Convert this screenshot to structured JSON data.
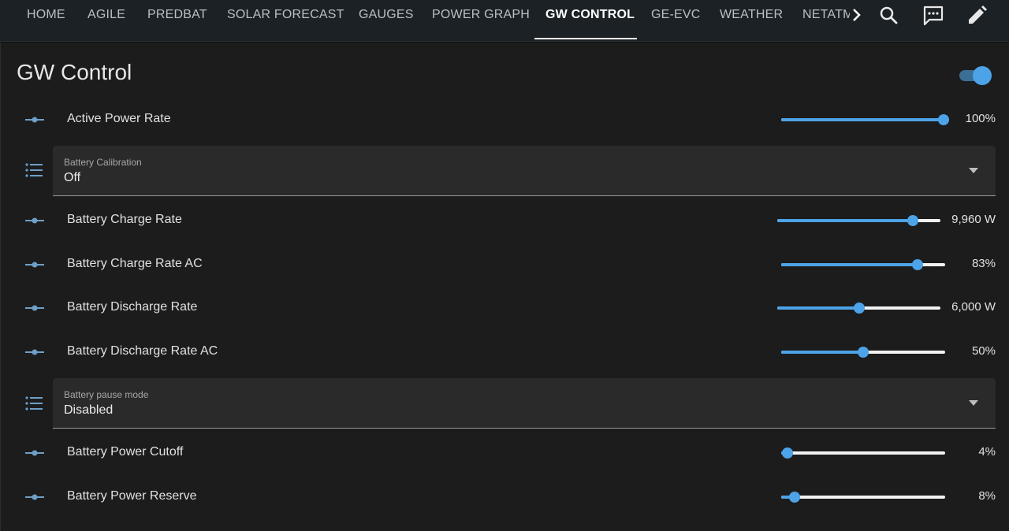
{
  "tabs": [
    {
      "label": "HOME"
    },
    {
      "label": "AGILE"
    },
    {
      "label": "PREDBAT"
    },
    {
      "label": "SOLAR FORECAST"
    },
    {
      "label": "GAUGES"
    },
    {
      "label": "POWER GRAPH"
    },
    {
      "label": "GW CONTROL"
    },
    {
      "label": "GE-EVC"
    },
    {
      "label": "WEATHER"
    },
    {
      "label": "NETATM"
    }
  ],
  "active_tab": "GW CONTROL",
  "toolbar_icons": [
    "search-icon",
    "chat-icon",
    "edit-icon"
  ],
  "accent_color": "#4da3e8",
  "card": {
    "title": "GW Control",
    "toggle_on": true
  },
  "rows": [
    {
      "label": "Active Power Rate",
      "value": "100%",
      "level": 1.0
    },
    {
      "select_label": "Battery Calibration",
      "select_value": "Off"
    },
    {
      "label": "Battery Charge Rate",
      "value": "9,960 W",
      "level": 0.83
    },
    {
      "label": "Battery Charge Rate AC",
      "value": "83%",
      "level": 0.83
    },
    {
      "label": "Battery Discharge Rate",
      "value": "6,000 W",
      "level": 0.5
    },
    {
      "label": "Battery Discharge Rate AC",
      "value": "50%",
      "level": 0.5
    },
    {
      "select_label": "Battery pause mode",
      "select_value": "Disabled"
    },
    {
      "label": "Battery Power Cutoff",
      "value": "4%",
      "level": 0.04
    },
    {
      "label": "Battery Power Reserve",
      "value": "8%",
      "level": 0.08
    }
  ]
}
